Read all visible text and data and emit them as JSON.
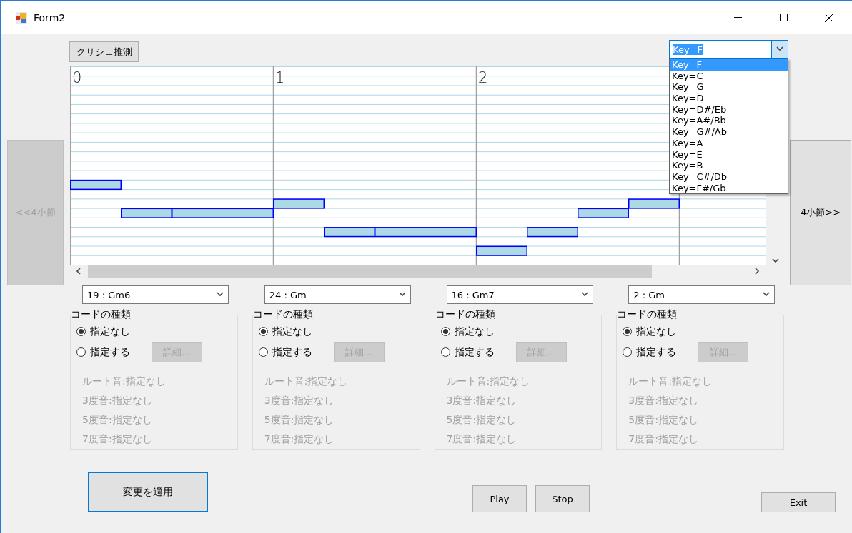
{
  "window": {
    "title": "Form2"
  },
  "cliche_button": {
    "label": "クリシェ推測"
  },
  "key_selector": {
    "value": "Key=F",
    "expanded": true,
    "options": [
      {
        "label": "Key=F",
        "selected": true
      },
      {
        "label": "Key=C",
        "selected": false
      },
      {
        "label": "Key=G",
        "selected": false
      },
      {
        "label": "Key=D",
        "selected": false
      },
      {
        "label": "Key=D#/Eb",
        "selected": false
      },
      {
        "label": "Key=A#/Bb",
        "selected": false
      },
      {
        "label": "Key=G#/Ab",
        "selected": false
      },
      {
        "label": "Key=A",
        "selected": false
      },
      {
        "label": "Key=E",
        "selected": false
      },
      {
        "label": "Key=B",
        "selected": false
      },
      {
        "label": "Key=C#/Db",
        "selected": false
      },
      {
        "label": "Key=F#/Gb",
        "selected": false
      }
    ]
  },
  "nav_buttons": [
    {
      "label": "<<4小節",
      "disabled": true
    },
    {
      "label": "4小節>>",
      "disabled": false
    }
  ],
  "piano_roll": {
    "measures": [
      "0",
      "1",
      "2"
    ]
  },
  "chord_panels": [
    {
      "chord": "19 : Gm6",
      "group_title": "コードの種類",
      "options": [
        {
          "label": "指定なし",
          "selected": true
        },
        {
          "label": "指定する",
          "selected": false
        }
      ],
      "detail_button": {
        "label": "詳細...",
        "disabled": true
      },
      "tones": [
        {
          "label": "ルート音:指定なし",
          "disabled": true
        },
        {
          "label": "3度音:指定なし",
          "disabled": true
        },
        {
          "label": "5度音:指定なし",
          "disabled": true
        },
        {
          "label": "7度音:指定なし",
          "disabled": true
        }
      ]
    },
    {
      "chord": "24 : Gm",
      "group_title": "コードの種類",
      "options": [
        {
          "label": "指定なし",
          "selected": true
        },
        {
          "label": "指定する",
          "selected": false
        }
      ],
      "detail_button": {
        "label": "詳細...",
        "disabled": true
      },
      "tones": [
        {
          "label": "ルート音:指定なし",
          "disabled": true
        },
        {
          "label": "3度音:指定なし",
          "disabled": true
        },
        {
          "label": "5度音:指定なし",
          "disabled": true
        },
        {
          "label": "7度音:指定なし",
          "disabled": true
        }
      ]
    },
    {
      "chord": "16 : Gm7",
      "group_title": "コードの種類",
      "options": [
        {
          "label": "指定なし",
          "selected": true
        },
        {
          "label": "指定する",
          "selected": false
        }
      ],
      "detail_button": {
        "label": "詳細...",
        "disabled": true
      },
      "tones": [
        {
          "label": "ルート音:指定なし",
          "disabled": true
        },
        {
          "label": "3度音:指定なし",
          "disabled": true
        },
        {
          "label": "5度音:指定なし",
          "disabled": true
        },
        {
          "label": "7度音:指定なし",
          "disabled": true
        }
      ]
    },
    {
      "chord": "2 : Gm",
      "group_title": "コードの種類",
      "options": [
        {
          "label": "指定なし",
          "selected": true
        },
        {
          "label": "指定する",
          "selected": false
        }
      ],
      "detail_button": {
        "label": "詳細...",
        "disabled": true
      },
      "tones": [
        {
          "label": "ルート音:指定なし",
          "disabled": true
        },
        {
          "label": "3度音:指定なし",
          "disabled": true
        },
        {
          "label": "5度音:指定なし",
          "disabled": true
        },
        {
          "label": "7度音:指定なし",
          "disabled": true
        }
      ]
    }
  ],
  "apply_button": {
    "label": "変更を適用",
    "focused": true
  },
  "play_buttons": [
    {
      "label": "Play"
    },
    {
      "label": "Stop"
    }
  ],
  "exit_button": {
    "label": "Exit"
  }
}
